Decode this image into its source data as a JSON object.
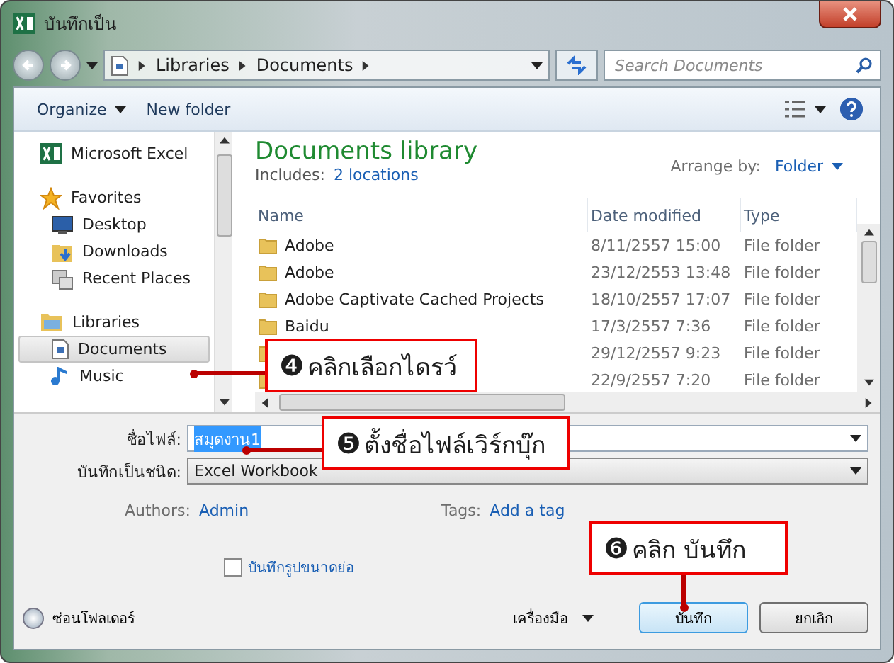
{
  "window": {
    "title": "บันทึกเป็น"
  },
  "address": {
    "crumbs": [
      "Libraries",
      "Documents"
    ],
    "search_placeholder": "Search Documents"
  },
  "toolbar": {
    "organize": "Organize",
    "new_folder": "New folder"
  },
  "nav": [
    {
      "label": "Microsoft Excel",
      "kind": "excel",
      "selected": false
    },
    {
      "label": "Favorites",
      "kind": "star",
      "selected": false
    },
    {
      "label": "Desktop",
      "kind": "desktop",
      "selected": false
    },
    {
      "label": "Downloads",
      "kind": "download",
      "selected": false
    },
    {
      "label": "Recent Places",
      "kind": "recent",
      "selected": false
    },
    {
      "label": "Libraries",
      "kind": "library",
      "selected": false
    },
    {
      "label": "Documents",
      "kind": "doc",
      "selected": true
    },
    {
      "label": "Music",
      "kind": "music",
      "selected": false
    }
  ],
  "library": {
    "title": "Documents library",
    "includes_label": "Includes:",
    "includes_link": "2 locations",
    "arrange_label": "Arrange by:",
    "arrange_value": "Folder"
  },
  "table": {
    "columns": [
      "Name",
      "Date modified",
      "Type"
    ],
    "rows": [
      {
        "name": "Adobe",
        "date": "8/11/2557 15:00",
        "type": "File folder"
      },
      {
        "name": "Adobe",
        "date": "23/12/2553 13:48",
        "type": "File folder"
      },
      {
        "name": "Adobe Captivate Cached Projects",
        "date": "18/10/2557 17:07",
        "type": "File folder"
      },
      {
        "name": "Baidu",
        "date": "17/3/2557 7:36",
        "type": "File folder"
      },
      {
        "date": "29/12/2557 9:23",
        "type": "File folder"
      },
      {
        "date": "22/9/2557 7:20",
        "type": "File folder"
      }
    ]
  },
  "form": {
    "filename_label": "ชื่อไฟล์:",
    "filename_value": "สมุดงาน1",
    "type_label": "บันทึกเป็นชนิด:",
    "type_value": "Excel Workbook",
    "authors_label": "Authors:",
    "authors_value": "Admin",
    "tags_label": "Tags:",
    "tags_value": "Add a tag",
    "thumbnail_label": "บันทึกรูปขนาดย่อ",
    "thumbnail_checked": false
  },
  "footer": {
    "hide_folders": "ซ่อนโฟลเดอร์",
    "tools": "เครื่องมือ",
    "save": "บันทึก",
    "cancel": "ยกเลิก"
  },
  "callouts": [
    {
      "number": "❹",
      "text": "คลิกเลือกไดรว์"
    },
    {
      "number": "❺",
      "text": "ตั้งชื่อไฟล์เวิร์กบุ๊ก"
    },
    {
      "number": "❻",
      "text": "คลิก บันทึก"
    }
  ]
}
